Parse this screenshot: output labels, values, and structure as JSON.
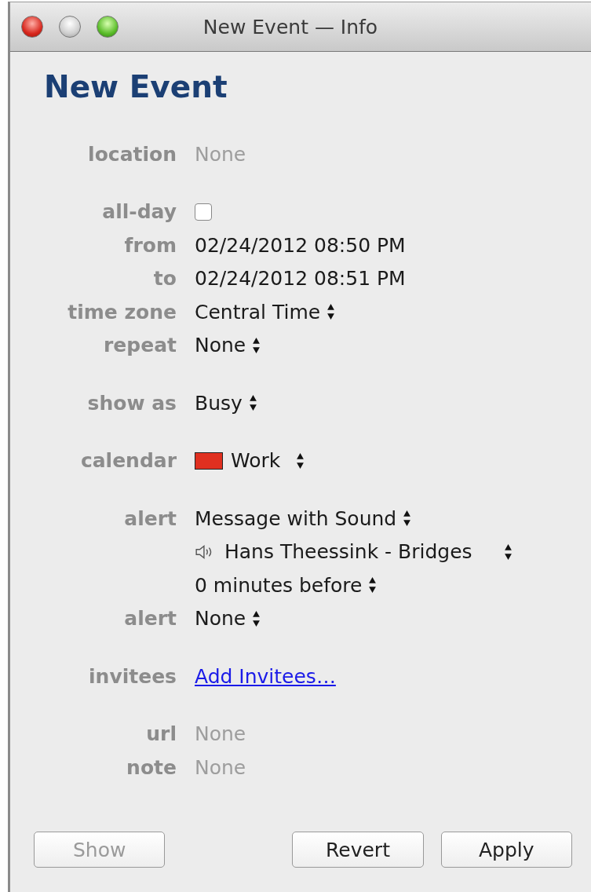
{
  "window": {
    "title": "New Event — Info"
  },
  "heading": "New Event",
  "sections": [
    {
      "rows": [
        {
          "label": "location",
          "kind": "text",
          "placeholder": "None"
        }
      ]
    },
    {
      "rows": [
        {
          "label": "all-day",
          "kind": "checkbox",
          "checked": false
        },
        {
          "label": "from",
          "kind": "text",
          "value": "02/24/2012 08:50 PM"
        },
        {
          "label": "to",
          "kind": "text",
          "value": "02/24/2012 08:51 PM"
        },
        {
          "label": "time zone",
          "kind": "popup",
          "value": "Central Time"
        },
        {
          "label": "repeat",
          "kind": "popup",
          "value": "None"
        }
      ]
    },
    {
      "rows": [
        {
          "label": "show as",
          "kind": "popup",
          "value": "Busy"
        }
      ]
    },
    {
      "rows": [
        {
          "label": "calendar",
          "kind": "calendar",
          "value": "Work",
          "color": "#e03020"
        }
      ]
    },
    {
      "rows": [
        {
          "label": "alert",
          "kind": "popup",
          "value": "Message with Sound"
        },
        {
          "kind": "sound",
          "value": "Hans Theessink - Bridges"
        },
        {
          "kind": "popup",
          "value": "0  minutes before"
        },
        {
          "label": "alert",
          "kind": "popup",
          "value": "None"
        }
      ]
    },
    {
      "rows": [
        {
          "label": "invitees",
          "kind": "link",
          "value": "Add Invitees…"
        }
      ]
    },
    {
      "rows": [
        {
          "label": "url",
          "kind": "text",
          "placeholder": "None"
        },
        {
          "label": "note",
          "kind": "text",
          "placeholder": "None"
        }
      ]
    }
  ],
  "buttons": [
    {
      "label": "Show",
      "disabled": true
    },
    {
      "label": "Revert",
      "disabled": false
    },
    {
      "label": "Apply",
      "disabled": false
    }
  ]
}
